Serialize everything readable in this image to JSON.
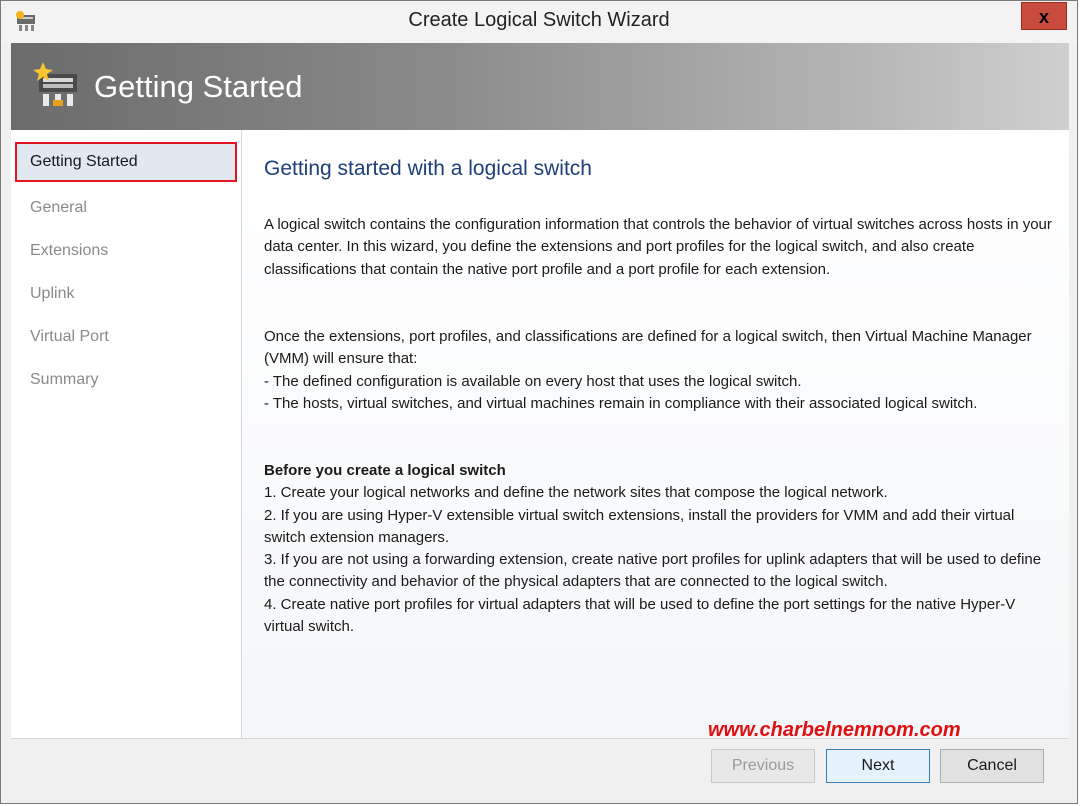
{
  "window": {
    "title": "Create Logical Switch Wizard",
    "close_label": "x"
  },
  "banner": {
    "title": "Getting Started"
  },
  "sidebar": {
    "items": [
      {
        "label": "Getting Started",
        "active": true
      },
      {
        "label": "General"
      },
      {
        "label": "Extensions"
      },
      {
        "label": "Uplink"
      },
      {
        "label": "Virtual Port"
      },
      {
        "label": "Summary"
      }
    ]
  },
  "main": {
    "heading": "Getting started with a logical switch",
    "intro": "A logical switch contains the configuration information that controls the behavior of virtual switches across hosts in your data center. In this wizard, you define the extensions and port profiles for the logical switch, and also create classifications that contain the native port profile and a port profile for each extension.",
    "once_lines": [
      "Once the extensions, port profiles, and classifications are defined for a logical switch, then Virtual Machine Manager (VMM) will ensure that:",
      "- The defined configuration is available on every host that uses the logical switch.",
      "- The hosts, virtual switches, and virtual machines remain in compliance with their associated logical switch."
    ],
    "before_title": "Before you create a logical switch",
    "before_steps": [
      "1. Create your logical networks and define the network sites that compose the logical network.",
      "2. If you are using Hyper-V extensible virtual switch extensions, install the providers for VMM and add their virtual switch extension managers.",
      "3. If you are not using a forwarding extension, create native port profiles for uplink adapters that will be used to define the connectivity and behavior of the physical adapters that are connected to the logical switch.",
      "4. Create native port profiles for virtual adapters that will be used to define the port settings for the native Hyper-V virtual switch."
    ]
  },
  "watermark": "www.charbelnemnom.com",
  "footer": {
    "previous_label": "Previous",
    "next_label": "Next",
    "cancel_label": "Cancel"
  },
  "colors": {
    "accent_heading": "#1e3f7a",
    "selection_border": "#e3171f",
    "watermark": "#e01010"
  }
}
